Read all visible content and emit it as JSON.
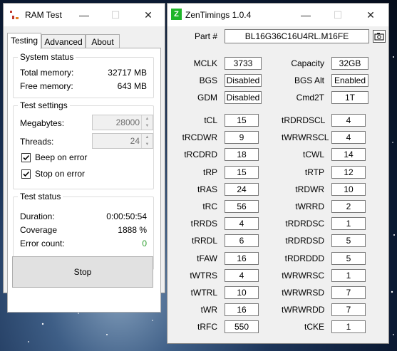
{
  "ram_test": {
    "title": "RAM Test",
    "tabs": [
      "Testing",
      "Advanced",
      "About"
    ],
    "system_status": {
      "title": "System status",
      "total_memory_label": "Total memory:",
      "total_memory_value": "32717 MB",
      "free_memory_label": "Free memory:",
      "free_memory_value": "643 MB"
    },
    "test_settings": {
      "title": "Test settings",
      "megabytes_label": "Megabytes:",
      "megabytes_value": "28000",
      "threads_label": "Threads:",
      "threads_value": "24",
      "beep_label": "Beep on error",
      "beep_checked": true,
      "stop_label": "Stop on error",
      "stop_checked": true
    },
    "test_status": {
      "title": "Test status",
      "duration_label": "Duration:",
      "duration_value": "0:00:50:54",
      "coverage_label": "Coverage",
      "coverage_value": "1888 %",
      "error_label": "Error count:",
      "error_value": "0",
      "error_color": "#2e9e2e"
    },
    "stop_button": "Stop"
  },
  "zen": {
    "title": "ZenTimings 1.0.4",
    "icon_letter": "Z",
    "icon_color": "#1fb52a",
    "part_label": "Part #",
    "part_value": "BL16G36C16U4RL.M16FE",
    "general": [
      {
        "l": "MCLK",
        "v": "3733",
        "l2": "Capacity",
        "v2": "32GB"
      },
      {
        "l": "BGS",
        "v": "Disabled",
        "l2": "BGS Alt",
        "v2": "Enabled"
      },
      {
        "l": "GDM",
        "v": "Disabled",
        "l2": "Cmd2T",
        "v2": "1T"
      }
    ],
    "timings": [
      {
        "l": "tCL",
        "v": "15",
        "l2": "tRDRDSCL",
        "v2": "4"
      },
      {
        "l": "tRCDWR",
        "v": "9",
        "l2": "tWRWRSCL",
        "v2": "4"
      },
      {
        "l": "tRCDRD",
        "v": "18",
        "l2": "tCWL",
        "v2": "14"
      },
      {
        "l": "tRP",
        "v": "15",
        "l2": "tRTP",
        "v2": "12"
      },
      {
        "l": "tRAS",
        "v": "24",
        "l2": "tRDWR",
        "v2": "10"
      },
      {
        "l": "tRC",
        "v": "56",
        "l2": "tWRRD",
        "v2": "2"
      },
      {
        "l": "tRRDS",
        "v": "4",
        "l2": "tRDRDSC",
        "v2": "1"
      },
      {
        "l": "tRRDL",
        "v": "6",
        "l2": "tRDRDSD",
        "v2": "5"
      },
      {
        "l": "tFAW",
        "v": "16",
        "l2": "tRDRDDD",
        "v2": "5"
      },
      {
        "l": "tWTRS",
        "v": "4",
        "l2": "tWRWRSC",
        "v2": "1"
      },
      {
        "l": "tWTRL",
        "v": "10",
        "l2": "tWRWRSD",
        "v2": "7"
      },
      {
        "l": "tWR",
        "v": "16",
        "l2": "tWRWRDD",
        "v2": "7"
      },
      {
        "l": "tRFC",
        "v": "550",
        "l2": "tCKE",
        "v2": "1"
      }
    ]
  }
}
